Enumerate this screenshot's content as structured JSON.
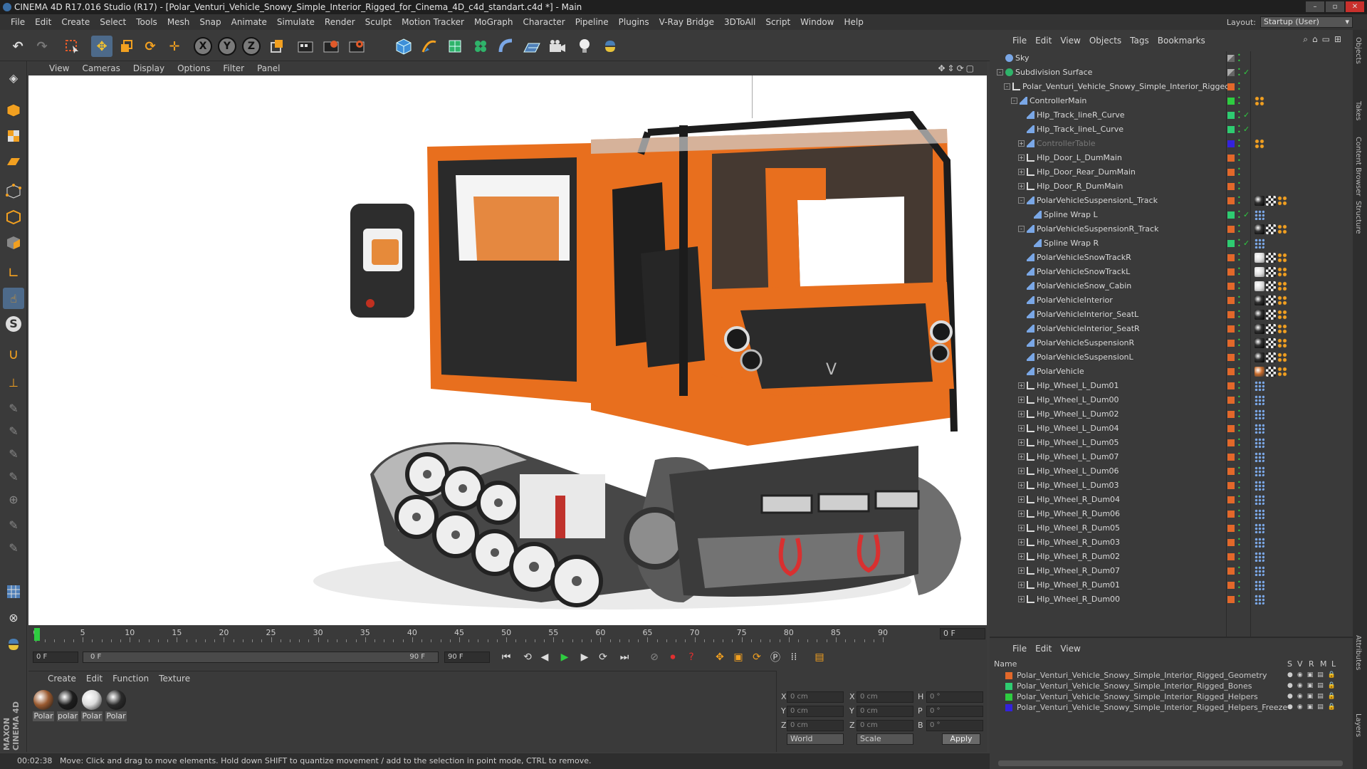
{
  "window": {
    "title": "CINEMA 4D R17.016 Studio (R17) - [Polar_Venturi_Vehicle_Snowy_Simple_Interior_Rigged_for_Cinema_4D_c4d_standart.c4d *] - Main"
  },
  "menu": [
    "File",
    "Edit",
    "Create",
    "Select",
    "Tools",
    "Mesh",
    "Snap",
    "Animate",
    "Simulate",
    "Render",
    "Sculpt",
    "Motion Tracker",
    "MoGraph",
    "Character",
    "Pipeline",
    "Plugins",
    "V-Ray Bridge",
    "3DToAll",
    "Script",
    "Window",
    "Help"
  ],
  "layout": {
    "label": "Layout:",
    "value": "Startup (User)"
  },
  "toolbar": {
    "x": "X",
    "y": "Y",
    "z": "Z"
  },
  "viewport_menu": [
    "View",
    "Cameras",
    "Display",
    "Options",
    "Filter",
    "Panel"
  ],
  "timeline": {
    "ticks": [
      "0",
      "5",
      "10",
      "15",
      "20",
      "25",
      "30",
      "35",
      "40",
      "45",
      "50",
      "55",
      "60",
      "65",
      "70",
      "75",
      "80",
      "85",
      "90"
    ],
    "frame_display": "0 F"
  },
  "transport": {
    "start_frame": "0 F",
    "slider_start": "0 F",
    "slider_end": "90 F",
    "end_frame": "90 F"
  },
  "materials": {
    "menu": [
      "Create",
      "Edit",
      "Function",
      "Texture"
    ],
    "items": [
      {
        "label": "Polar",
        "color": "#9a5a30"
      },
      {
        "label": "polar",
        "color": "#1d1d1d"
      },
      {
        "label": "Polar",
        "color": "#dcdcdc"
      },
      {
        "label": "Polar",
        "color": "#2a2a2a"
      }
    ]
  },
  "coords": {
    "x_pos": "0 cm",
    "y_pos": "0 cm",
    "z_pos": "0 cm",
    "x_size": "0 cm",
    "y_size": "0 cm",
    "z_size": "0 cm",
    "h": "0 °",
    "p": "0 °",
    "b": "0 °",
    "mode1": "World",
    "mode2": "Scale",
    "apply": "Apply",
    "labels": {
      "x": "X",
      "y": "Y",
      "z": "Z",
      "h": "H",
      "p": "P",
      "b": "B"
    }
  },
  "status": {
    "time": "00:02:38",
    "message": "Move: Click and drag to move elements. Hold down SHIFT to quantize movement / add to the selection in point mode, CTRL to remove."
  },
  "objects_panel": {
    "menu": [
      "File",
      "Edit",
      "View",
      "Objects",
      "Tags",
      "Bookmarks"
    ],
    "rows": [
      {
        "name": "Sky",
        "indent": 0,
        "expander": "",
        "icon": "sky",
        "layer": "",
        "check": "",
        "tags": []
      },
      {
        "name": "Subdivision Surface",
        "indent": 0,
        "expander": "-",
        "icon": "subdiv",
        "layer": "",
        "check": "✓",
        "tags": []
      },
      {
        "name": "Polar_Venturi_Vehicle_Snowy_Simple_Interior_Rigged",
        "indent": 1,
        "expander": "-",
        "icon": "null",
        "layer": "#e2682a",
        "check": "",
        "tags": []
      },
      {
        "name": "ControllerMain",
        "indent": 2,
        "expander": "-",
        "icon": "poly",
        "layer": "#2ecc40",
        "check": "",
        "tags": [
          "dots"
        ]
      },
      {
        "name": "Hlp_Track_lineR_Curve",
        "indent": 3,
        "expander": "",
        "icon": "spline",
        "layer": "#2ecc71",
        "check": "✓",
        "tags": []
      },
      {
        "name": "Hlp_Track_lineL_Curve",
        "indent": 3,
        "expander": "",
        "icon": "spline",
        "layer": "#2ecc71",
        "check": "✓",
        "tags": []
      },
      {
        "name": "ControllerTable",
        "indent": 3,
        "expander": "+",
        "icon": "poly",
        "layer": "#3322dd",
        "check": "",
        "tags": [
          "dots"
        ],
        "dim": true
      },
      {
        "name": "Hlp_Door_L_DumMain",
        "indent": 3,
        "expander": "+",
        "icon": "null",
        "layer": "#e2682a",
        "check": "",
        "tags": []
      },
      {
        "name": "Hlp_Door_Rear_DumMain",
        "indent": 3,
        "expander": "+",
        "icon": "null",
        "layer": "#e2682a",
        "check": "",
        "tags": []
      },
      {
        "name": "Hlp_Door_R_DumMain",
        "indent": 3,
        "expander": "+",
        "icon": "null",
        "layer": "#e2682a",
        "check": "",
        "tags": []
      },
      {
        "name": "PolarVehicleSuspensionL_Track",
        "indent": 3,
        "expander": "-",
        "icon": "poly",
        "layer": "#e2682a",
        "check": "",
        "tags": [
          "dark",
          "check",
          "dots"
        ]
      },
      {
        "name": "Spline Wrap L",
        "indent": 4,
        "expander": "",
        "icon": "wrap",
        "layer": "#2ecc71",
        "check": "✓",
        "tags": [
          "pts"
        ]
      },
      {
        "name": "PolarVehicleSuspensionR_Track",
        "indent": 3,
        "expander": "-",
        "icon": "poly",
        "layer": "#e2682a",
        "check": "",
        "tags": [
          "dark",
          "check",
          "dots"
        ]
      },
      {
        "name": "Spline Wrap R",
        "indent": 4,
        "expander": "",
        "icon": "wrap",
        "layer": "#2ecc71",
        "check": "✓",
        "tags": [
          "pts"
        ]
      },
      {
        "name": "PolarVehicleSnowTrackR",
        "indent": 3,
        "expander": "",
        "icon": "poly",
        "layer": "#e2682a",
        "check": "",
        "tags": [
          "white",
          "check",
          "dots"
        ]
      },
      {
        "name": "PolarVehicleSnowTrackL",
        "indent": 3,
        "expander": "",
        "icon": "poly",
        "layer": "#e2682a",
        "check": "",
        "tags": [
          "white",
          "check",
          "dots"
        ]
      },
      {
        "name": "PolarVehicleSnow_Cabin",
        "indent": 3,
        "expander": "",
        "icon": "poly",
        "layer": "#e2682a",
        "check": "",
        "tags": [
          "white",
          "check",
          "dots"
        ]
      },
      {
        "name": "PolarVehicleInterior",
        "indent": 3,
        "expander": "",
        "icon": "poly",
        "layer": "#e2682a",
        "check": "",
        "tags": [
          "dark",
          "check",
          "dots"
        ]
      },
      {
        "name": "PolarVehicleInterior_SeatL",
        "indent": 3,
        "expander": "",
        "icon": "poly",
        "layer": "#e2682a",
        "check": "",
        "tags": [
          "dark",
          "check",
          "dots"
        ]
      },
      {
        "name": "PolarVehicleInterior_SeatR",
        "indent": 3,
        "expander": "",
        "icon": "poly",
        "layer": "#e2682a",
        "check": "",
        "tags": [
          "dark",
          "check",
          "dots"
        ]
      },
      {
        "name": "PolarVehicleSuspensionR",
        "indent": 3,
        "expander": "",
        "icon": "poly",
        "layer": "#e2682a",
        "check": "",
        "tags": [
          "dark",
          "check",
          "dots"
        ]
      },
      {
        "name": "PolarVehicleSuspensionL",
        "indent": 3,
        "expander": "",
        "icon": "poly",
        "layer": "#e2682a",
        "check": "",
        "tags": [
          "dark",
          "check",
          "dots"
        ]
      },
      {
        "name": "PolarVehicle",
        "indent": 3,
        "expander": "",
        "icon": "poly",
        "layer": "#e2682a",
        "check": "",
        "tags": [
          "orange",
          "check",
          "dots"
        ]
      },
      {
        "name": "Hlp_Wheel_L_Dum01",
        "indent": 3,
        "expander": "+",
        "icon": "null",
        "layer": "#e2682a",
        "check": "",
        "tags": [
          "pts"
        ]
      },
      {
        "name": "Hlp_Wheel_L_Dum00",
        "indent": 3,
        "expander": "+",
        "icon": "null",
        "layer": "#e2682a",
        "check": "",
        "tags": [
          "pts"
        ]
      },
      {
        "name": "Hlp_Wheel_L_Dum02",
        "indent": 3,
        "expander": "+",
        "icon": "null",
        "layer": "#e2682a",
        "check": "",
        "tags": [
          "pts"
        ]
      },
      {
        "name": "Hlp_Wheel_L_Dum04",
        "indent": 3,
        "expander": "+",
        "icon": "null",
        "layer": "#e2682a",
        "check": "",
        "tags": [
          "pts"
        ]
      },
      {
        "name": "Hlp_Wheel_L_Dum05",
        "indent": 3,
        "expander": "+",
        "icon": "null",
        "layer": "#e2682a",
        "check": "",
        "tags": [
          "pts"
        ]
      },
      {
        "name": "Hlp_Wheel_L_Dum07",
        "indent": 3,
        "expander": "+",
        "icon": "null",
        "layer": "#e2682a",
        "check": "",
        "tags": [
          "pts"
        ]
      },
      {
        "name": "Hlp_Wheel_L_Dum06",
        "indent": 3,
        "expander": "+",
        "icon": "null",
        "layer": "#e2682a",
        "check": "",
        "tags": [
          "pts"
        ]
      },
      {
        "name": "Hlp_Wheel_L_Dum03",
        "indent": 3,
        "expander": "+",
        "icon": "null",
        "layer": "#e2682a",
        "check": "",
        "tags": [
          "pts"
        ]
      },
      {
        "name": "Hlp_Wheel_R_Dum04",
        "indent": 3,
        "expander": "+",
        "icon": "null",
        "layer": "#e2682a",
        "check": "",
        "tags": [
          "pts"
        ]
      },
      {
        "name": "Hlp_Wheel_R_Dum06",
        "indent": 3,
        "expander": "+",
        "icon": "null",
        "layer": "#e2682a",
        "check": "",
        "tags": [
          "pts"
        ]
      },
      {
        "name": "Hlp_Wheel_R_Dum05",
        "indent": 3,
        "expander": "+",
        "icon": "null",
        "layer": "#e2682a",
        "check": "",
        "tags": [
          "pts"
        ]
      },
      {
        "name": "Hlp_Wheel_R_Dum03",
        "indent": 3,
        "expander": "+",
        "icon": "null",
        "layer": "#e2682a",
        "check": "",
        "tags": [
          "pts"
        ]
      },
      {
        "name": "Hlp_Wheel_R_Dum02",
        "indent": 3,
        "expander": "+",
        "icon": "null",
        "layer": "#e2682a",
        "check": "",
        "tags": [
          "pts"
        ]
      },
      {
        "name": "Hlp_Wheel_R_Dum07",
        "indent": 3,
        "expander": "+",
        "icon": "null",
        "layer": "#e2682a",
        "check": "",
        "tags": [
          "pts"
        ]
      },
      {
        "name": "Hlp_Wheel_R_Dum01",
        "indent": 3,
        "expander": "+",
        "icon": "null",
        "layer": "#e2682a",
        "check": "",
        "tags": [
          "pts"
        ]
      },
      {
        "name": "Hlp_Wheel_R_Dum00",
        "indent": 3,
        "expander": "+",
        "icon": "null",
        "layer": "#e2682a",
        "check": "",
        "tags": [
          "pts"
        ]
      }
    ]
  },
  "layers_panel": {
    "menu": [
      "File",
      "Edit",
      "View"
    ],
    "header": {
      "name": "Name",
      "s": "S",
      "v": "V",
      "r": "R",
      "m": "M",
      "l": "L"
    },
    "rows": [
      {
        "name": "Polar_Venturi_Vehicle_Snowy_Simple_Interior_Rigged_Geometry",
        "color": "#e2682a"
      },
      {
        "name": "Polar_Venturi_Vehicle_Snowy_Simple_Interior_Rigged_Bones",
        "color": "#2ecc71"
      },
      {
        "name": "Polar_Venturi_Vehicle_Snowy_Simple_Interior_Rigged_Helpers",
        "color": "#2ecc40"
      },
      {
        "name": "Polar_Venturi_Vehicle_Snowy_Simple_Interior_Rigged_Helpers_Freeze",
        "color": "#3322dd"
      }
    ]
  },
  "side_tabs": [
    "Objects",
    "Takes",
    "Content Browser",
    "Structure",
    "Attributes",
    "Layers"
  ],
  "maxon_logo": "MAXON CINEMA 4D"
}
